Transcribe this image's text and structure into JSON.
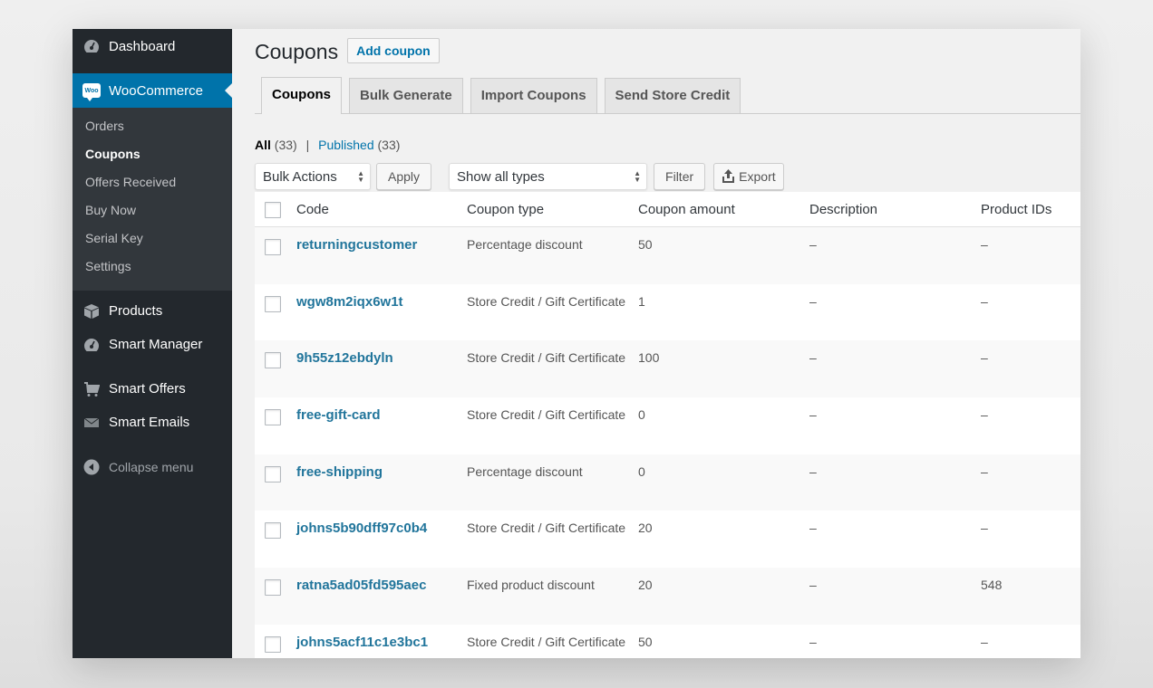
{
  "sidebar": {
    "dashboard": "Dashboard",
    "woocommerce": "WooCommerce",
    "woo_badge": "Woo",
    "submenu": [
      {
        "label": "Orders",
        "active": false
      },
      {
        "label": "Coupons",
        "active": true
      },
      {
        "label": "Offers Received",
        "active": false
      },
      {
        "label": "Buy Now",
        "active": false
      },
      {
        "label": "Serial Key",
        "active": false
      },
      {
        "label": "Settings",
        "active": false
      }
    ],
    "products": "Products",
    "smart_manager": "Smart Manager",
    "smart_offers": "Smart Offers",
    "smart_emails": "Smart Emails",
    "collapse": "Collapse menu"
  },
  "header": {
    "title": "Coupons",
    "add_button": "Add coupon"
  },
  "tabs": [
    {
      "label": "Coupons",
      "active": true
    },
    {
      "label": "Bulk Generate",
      "active": false
    },
    {
      "label": "Import Coupons",
      "active": false
    },
    {
      "label": "Send Store Credit",
      "active": false
    }
  ],
  "filters": {
    "all_label": "All",
    "all_count": "(33)",
    "separator": "|",
    "published_label": "Published",
    "published_count": "(33)"
  },
  "toolbar": {
    "bulk_actions": "Bulk Actions",
    "apply": "Apply",
    "type_filter": "Show all types",
    "filter": "Filter",
    "export": "Export"
  },
  "table": {
    "columns": [
      "Code",
      "Coupon type",
      "Coupon amount",
      "Description",
      "Product IDs"
    ],
    "rows": [
      {
        "code": "returningcustomer",
        "type": "Percentage discount",
        "amount": "50",
        "description": "–",
        "product_ids": "–"
      },
      {
        "code": "wgw8m2iqx6w1t",
        "type": "Store Credit / Gift Certificate",
        "amount": "1",
        "description": "–",
        "product_ids": "–"
      },
      {
        "code": "9h55z12ebdyln",
        "type": "Store Credit / Gift Certificate",
        "amount": "100",
        "description": "–",
        "product_ids": "–"
      },
      {
        "code": "free-gift-card",
        "type": "Store Credit / Gift Certificate",
        "amount": "0",
        "description": "–",
        "product_ids": "–"
      },
      {
        "code": "free-shipping",
        "type": "Percentage discount",
        "amount": "0",
        "description": "–",
        "product_ids": "–"
      },
      {
        "code": "johns5b90dff97c0b4",
        "type": "Store Credit / Gift Certificate",
        "amount": "20",
        "description": "–",
        "product_ids": "–"
      },
      {
        "code": "ratna5ad05fd595aec",
        "type": "Fixed product discount",
        "amount": "20",
        "description": "–",
        "product_ids": "548"
      },
      {
        "code": "johns5acf11c1e3bc1",
        "type": "Store Credit / Gift Certificate",
        "amount": "50",
        "description": "–",
        "product_ids": "–"
      }
    ]
  },
  "colors": {
    "sidebar_bg": "#23282d",
    "submenu_bg": "#32373c",
    "accent": "#0073aa",
    "link": "#21759b"
  }
}
